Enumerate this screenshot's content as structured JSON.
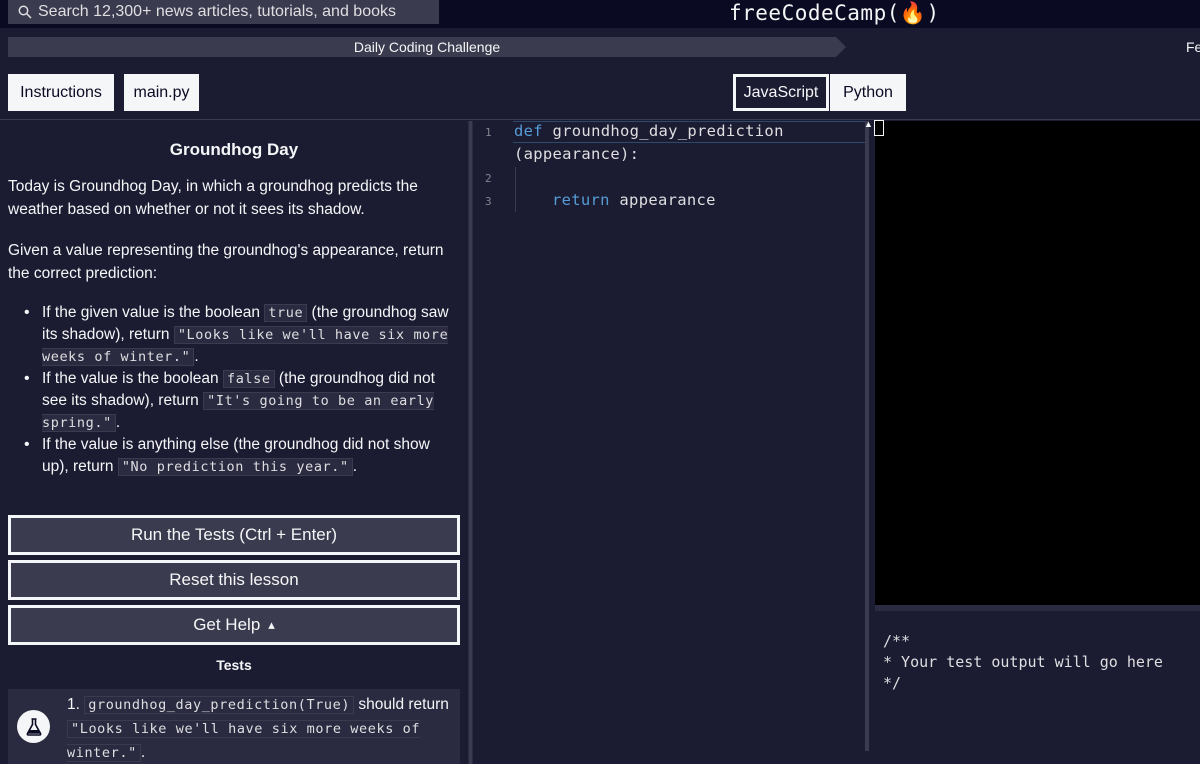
{
  "nav": {
    "search_placeholder": "Search 12,300+ news articles, tutorials, and books",
    "logo": "freeCodeCamp(🔥)"
  },
  "breadcrumb": {
    "label": "Daily Coding Challenge",
    "tail": "Fe"
  },
  "tabs": {
    "instructions": "Instructions",
    "file": "main.py",
    "javascript": "JavaScript",
    "python": "Python"
  },
  "lesson": {
    "title": "Groundhog Day",
    "intro": "Today is Groundhog Day, in which a groundhog predicts the weather based on whether or not it sees its shadow.",
    "task": "Given a value representing the groundhog's appearance, return the correct prediction:",
    "rules": [
      {
        "pre": "If the given value is the boolean ",
        "code1": "true",
        "mid": " (the groundhog saw its shadow), return ",
        "code2": "\"Looks like we'll have six more weeks of winter.\"",
        "post": "."
      },
      {
        "pre": "If the value is the boolean ",
        "code1": "false",
        "mid": " (the groundhog did not see its shadow), return ",
        "code2": "\"It's going to be an early spring.\"",
        "post": "."
      },
      {
        "pre": "If the value is anything else (the groundhog did not show up), return ",
        "code2": "\"No prediction this year.\"",
        "post": "."
      }
    ]
  },
  "buttons": {
    "run": "Run the Tests (Ctrl + Enter)",
    "reset": "Reset this lesson",
    "help": "Get Help",
    "help_arrow": "▴"
  },
  "tests": {
    "heading": "Tests",
    "items": [
      {
        "num": "1.",
        "code": "groundhog_day_prediction(True)",
        "text": " should return ",
        "expected": "\"Looks like we'll have six more weeks of winter.\"",
        "post": "."
      }
    ]
  },
  "editor": {
    "lines": [
      "1",
      "2",
      "3"
    ],
    "line1_kw": "def",
    "line1_rest": " groundhog_day_prediction",
    "line1_cont": "(appearance):",
    "line3_kw": "return",
    "line3_rest": " appearance"
  },
  "console": {
    "output": "/**\n* Your test output will go here\n*/"
  },
  "colors": {
    "background": "#1b1b32",
    "nav": "#0a0a23",
    "keyword": "#569cd6"
  }
}
